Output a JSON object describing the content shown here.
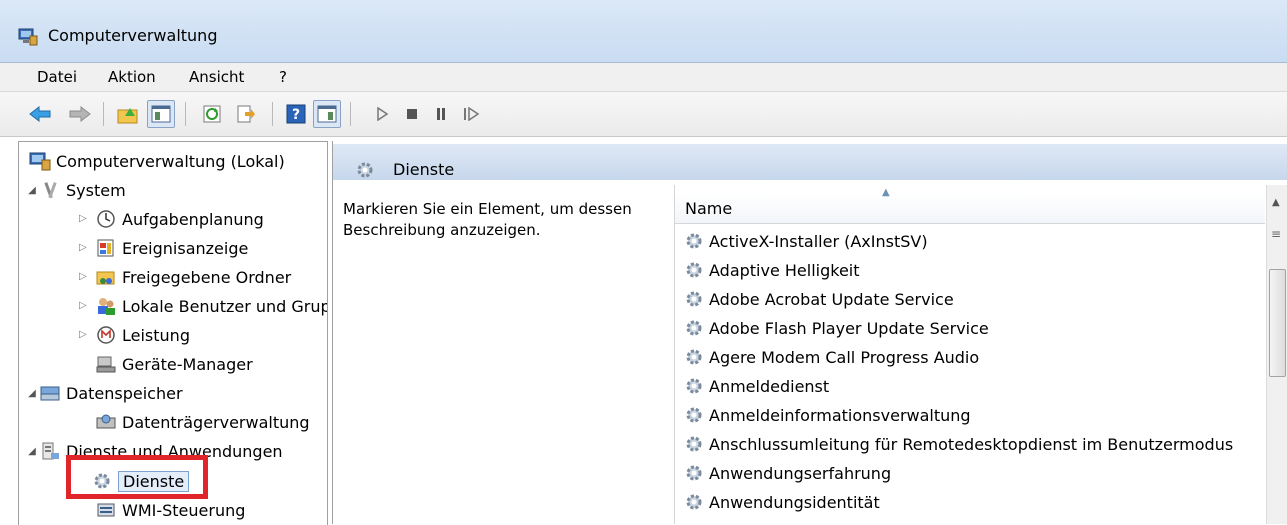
{
  "window": {
    "title": "Computerverwaltung"
  },
  "menu": [
    "Datei",
    "Aktion",
    "Ansicht",
    "?"
  ],
  "toolbar": {
    "icons": [
      "back-arrow-icon",
      "forward-arrow-icon",
      "up-folder-icon",
      "show-hide-console-tree-icon",
      "refresh-icon",
      "export-list-icon",
      "help-icon",
      "show-hide-action-pane-icon",
      "start-service-icon",
      "stop-service-icon",
      "pause-service-icon",
      "restart-service-icon"
    ]
  },
  "tree": {
    "root": "Computerverwaltung (Lokal)",
    "system": "System",
    "aufgabenplanung": "Aufgabenplanung",
    "ereignisanzeige": "Ereignisanzeige",
    "freigegebene": "Freigegebene Ordner",
    "lokale": "Lokale Benutzer und Gruppen",
    "leistung": "Leistung",
    "geraete": "Geräte-Manager",
    "datenspeicher": "Datenspeicher",
    "datentraeger": "Datenträgerverwaltung",
    "dienste_anw": "Dienste und Anwendungen",
    "dienste": "Dienste",
    "wmi": "WMI-Steuerung"
  },
  "pane": {
    "title": "Dienste",
    "description": "Markieren Sie ein Element, um dessen Beschreibung anzuzeigen.",
    "column_name": "Name",
    "services": [
      "ActiveX-Installer (AxInstSV)",
      "Adaptive Helligkeit",
      "Adobe Acrobat Update Service",
      "Adobe Flash Player Update Service",
      "Agere Modem Call Progress Audio",
      "Anmeldedienst",
      "Anmeldeinformationsverwaltung",
      "Anschlussumleitung für Remotedesktopdienst im Benutzermodus",
      "Anwendungserfahrung",
      "Anwendungsidentität"
    ]
  },
  "colors": {
    "highlight_box": "#e0262a",
    "header_blue": "#c7d7ec"
  }
}
